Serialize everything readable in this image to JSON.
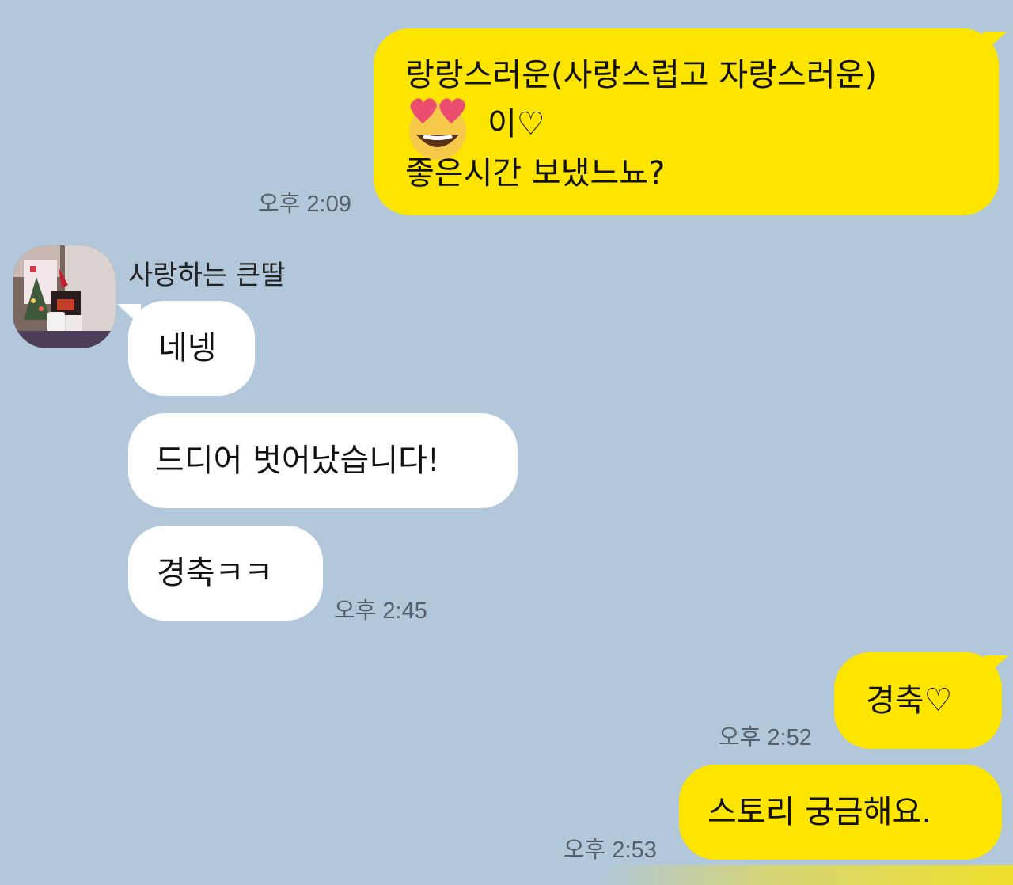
{
  "messages": [
    {
      "from": "me",
      "lines": [
        "랑랑스러운(사랑스럽고 자랑스러운)",
        "이♡",
        "좋은시간 보냈느뇨?"
      ],
      "time": "오후 2:09"
    },
    {
      "from": "them",
      "sender": "사랑하는 큰딸",
      "bubbles": [
        "네넹",
        "드디어 벗어났습니다!",
        "경축ㅋㅋ"
      ],
      "time": "오후 2:45"
    },
    {
      "from": "me",
      "text": "경축♡",
      "time": "오후 2:52"
    },
    {
      "from": "me",
      "text": "스토리 궁금해요.",
      "time": "오후 2:53"
    }
  ],
  "icons": {
    "sticker": "heart-eyes-emoji-icon",
    "avatar": "profile-photo"
  },
  "colors": {
    "background": "#b2c7da",
    "my_bubble": "#fee500",
    "their_bubble": "#ffffff",
    "time_text": "#55606b"
  }
}
